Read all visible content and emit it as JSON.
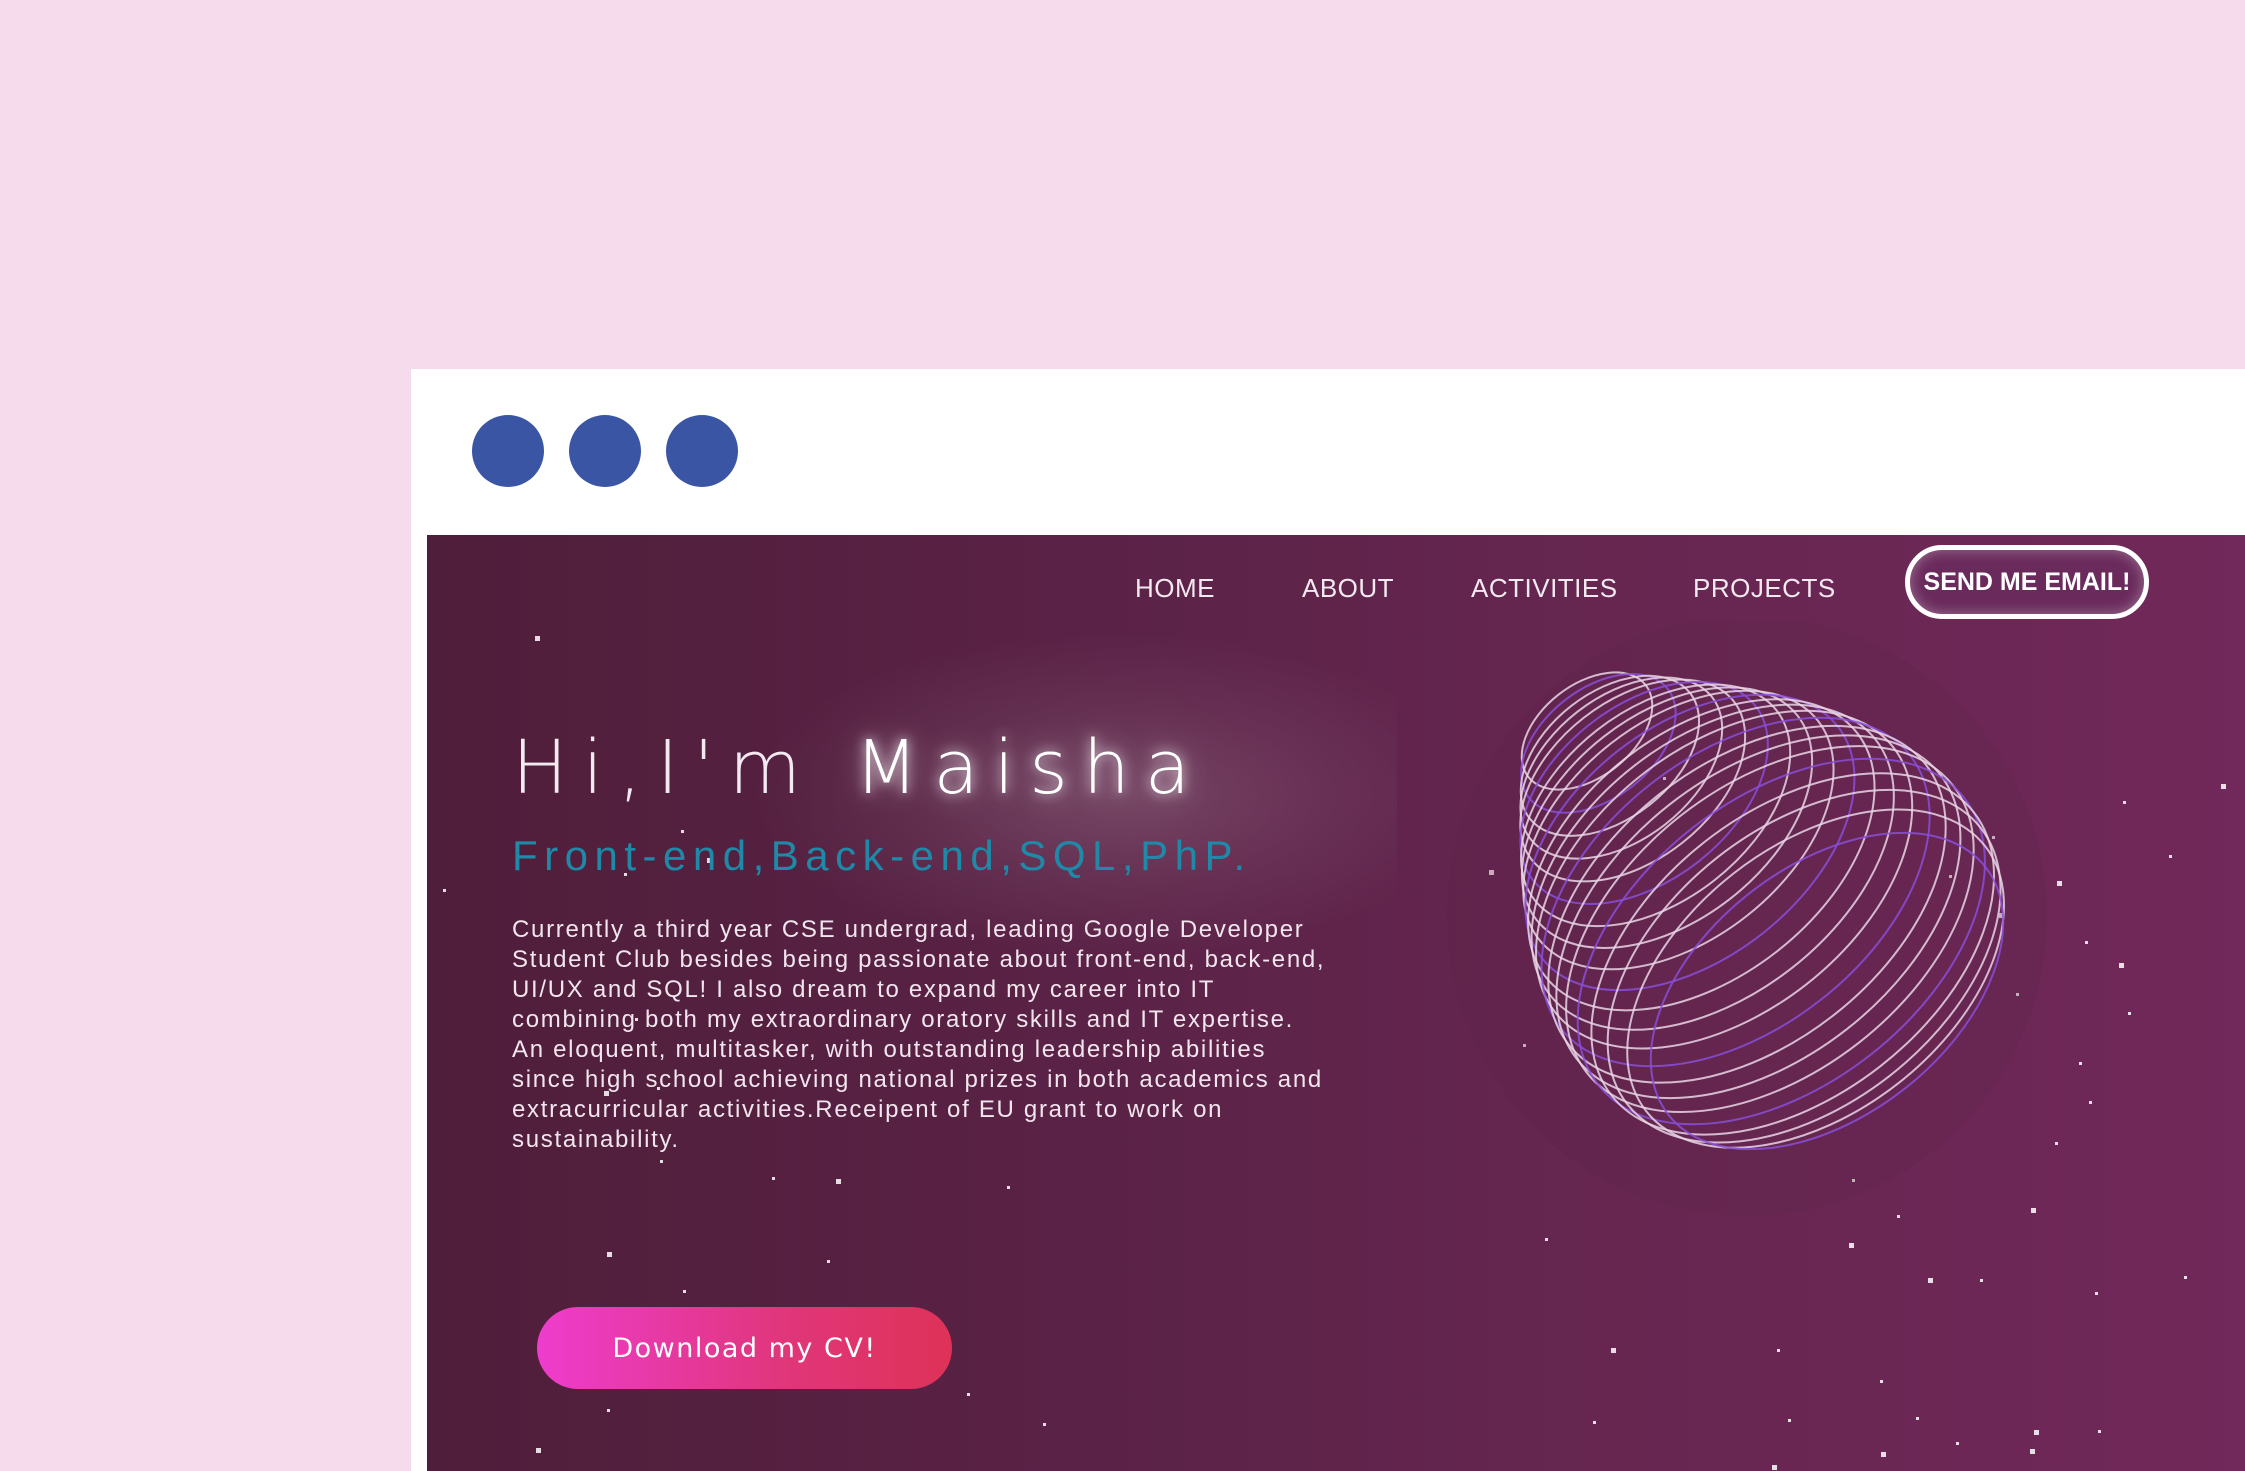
{
  "window_controls": [
    "window-dot",
    "window-dot",
    "window-dot"
  ],
  "nav": {
    "items": [
      {
        "label": "HOME"
      },
      {
        "label": "ABOUT"
      },
      {
        "label": "ACTIVITIES"
      },
      {
        "label": "PROJECTS"
      }
    ],
    "email_button": "SEND ME EMAIL!"
  },
  "hero": {
    "greeting_prefix": "Hi,I'm ",
    "name": "Maisha",
    "skills": "Front-end,Back-end,SQL,PhP.",
    "bio": "Currently a third year CSE undergrad, leading Google Developer Student Club besides being passionate about front-end, back-end, UI/UX and SQL! I also dream to expand my career into IT combining both my extraordinary oratory skills and IT expertise. An eloquent, multitasker, with outstanding leadership abilities since high school achieving national prizes in both academics and extracurricular activities.Receipent of EU grant to work on sustainability.",
    "cv_button": "Download my CV!"
  },
  "colors": {
    "page_bg": "#f5dbec",
    "window_dot": "#3b55a5",
    "skills_text": "#1f89a8",
    "cv_button_start": "#ee3ccd",
    "cv_button_end": "#de3257"
  },
  "icons": {
    "sphere": "wireframe-planet-graphic",
    "stars": "star-field-decoration"
  }
}
